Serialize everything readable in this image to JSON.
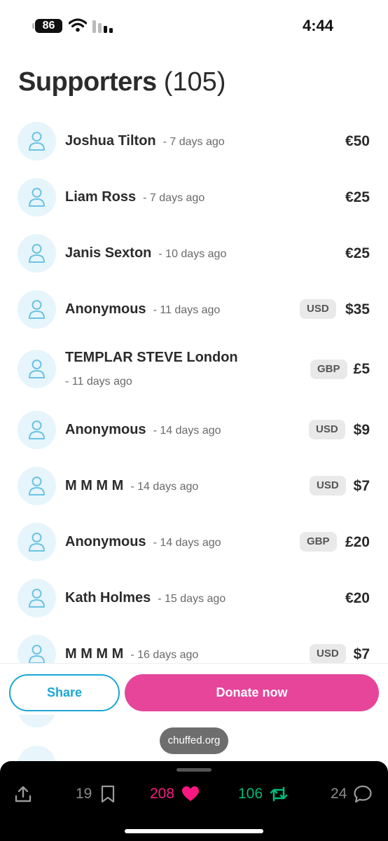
{
  "status_bar": {
    "battery": "86",
    "time": "4:44"
  },
  "header": {
    "title": "Supporters",
    "count": "(105)"
  },
  "supporters": [
    {
      "name": "Joshua Tilton",
      "ago": "- 7 days ago",
      "currency": "",
      "amount": "€50"
    },
    {
      "name": "Liam Ross",
      "ago": "- 7 days ago",
      "currency": "",
      "amount": "€25"
    },
    {
      "name": "Janis Sexton",
      "ago": "- 10 days ago",
      "currency": "",
      "amount": "€25"
    },
    {
      "name": "Anonymous",
      "ago": "- 11 days ago",
      "currency": "USD",
      "amount": "$35"
    },
    {
      "name": "TEMPLAR STEVE London",
      "ago": "- 11 days ago",
      "currency": "GBP",
      "amount": "£5"
    },
    {
      "name": "Anonymous",
      "ago": "- 14 days ago",
      "currency": "USD",
      "amount": "$9"
    },
    {
      "name": "M M M M",
      "ago": "- 14 days ago",
      "currency": "USD",
      "amount": "$7"
    },
    {
      "name": "Anonymous",
      "ago": "- 14 days ago",
      "currency": "GBP",
      "amount": "£20"
    },
    {
      "name": "Kath Holmes",
      "ago": "- 15 days ago",
      "currency": "",
      "amount": "€20"
    },
    {
      "name": "M M M M",
      "ago": "- 16 days ago",
      "currency": "USD",
      "amount": "$7"
    }
  ],
  "actions": {
    "share_label": "Share",
    "donate_label": "Donate now"
  },
  "site_pill": "chuffed.org",
  "tweet_toolbar": {
    "bookmarks": "19",
    "likes": "208",
    "retweets": "106",
    "replies": "24"
  },
  "colors": {
    "accent_blue": "#1aa6d4",
    "donate_pink": "#e6459a",
    "like_pink": "#f91880",
    "retweet_green": "#00ba7c"
  }
}
